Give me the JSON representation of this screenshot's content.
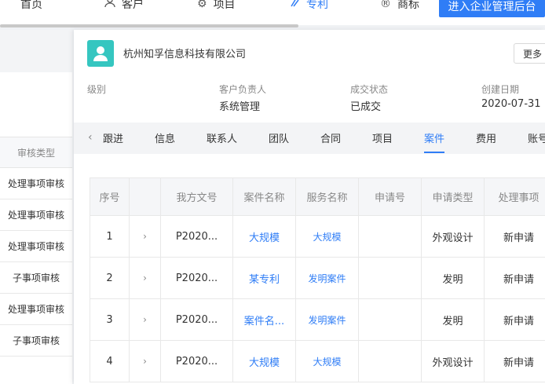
{
  "nav": {
    "items": [
      {
        "label": "首页",
        "icon": "home-icon"
      },
      {
        "label": "客户",
        "icon": "customer-icon"
      },
      {
        "label": "项目",
        "icon": "gear-icon"
      },
      {
        "label": "专利",
        "icon": "patent-icon"
      },
      {
        "label": "商标",
        "icon": "registered-trademark-icon"
      }
    ],
    "active": "专利",
    "enter_button": "进入企业管理后台"
  },
  "left_list": {
    "header": "审核类型",
    "rows": [
      "处理事项审核",
      "处理事项审核",
      "处理事项审核",
      "子事项审核",
      "处理事项审核",
      "子事项审核"
    ]
  },
  "company": {
    "name": "杭州知孚信息科技有限公司",
    "more_button": "更多",
    "info": [
      {
        "label": "级别",
        "value": ""
      },
      {
        "label": "客户负责人",
        "value": "系统管理"
      },
      {
        "label": "成交状态",
        "value": "已成交"
      },
      {
        "label": "创建日期",
        "value": "2020-07-31"
      }
    ]
  },
  "tabs": {
    "items": [
      "跟进",
      "信息",
      "联系人",
      "团队",
      "合同",
      "项目",
      "案件",
      "费用",
      "账号"
    ],
    "active": "案件"
  },
  "table": {
    "columns": [
      "序号",
      "",
      "我方文号",
      "案件名称",
      "服务名称",
      "申请号",
      "申请类型",
      "处理事项"
    ],
    "rows": [
      {
        "index": "1",
        "doc_no": "P2020...",
        "case_name": "大规模",
        "service": "大规模",
        "app_no": "",
        "app_type": "外观设计",
        "todo": "新申请"
      },
      {
        "index": "2",
        "doc_no": "P2020...",
        "case_name": "某专利",
        "service": "发明案件",
        "app_no": "",
        "app_type": "发明",
        "todo": "新申请"
      },
      {
        "index": "3",
        "doc_no": "P2020...",
        "case_name": "案件名...",
        "service": "发明案件",
        "app_no": "",
        "app_type": "发明",
        "todo": "新申请"
      },
      {
        "index": "4",
        "doc_no": "P2020...",
        "case_name": "大规模",
        "service": "大规模",
        "app_no": "",
        "app_type": "外观设计",
        "todo": "新申请"
      }
    ]
  },
  "colors": {
    "accent": "#2f7df6",
    "company_icon": "#35c6c0"
  }
}
